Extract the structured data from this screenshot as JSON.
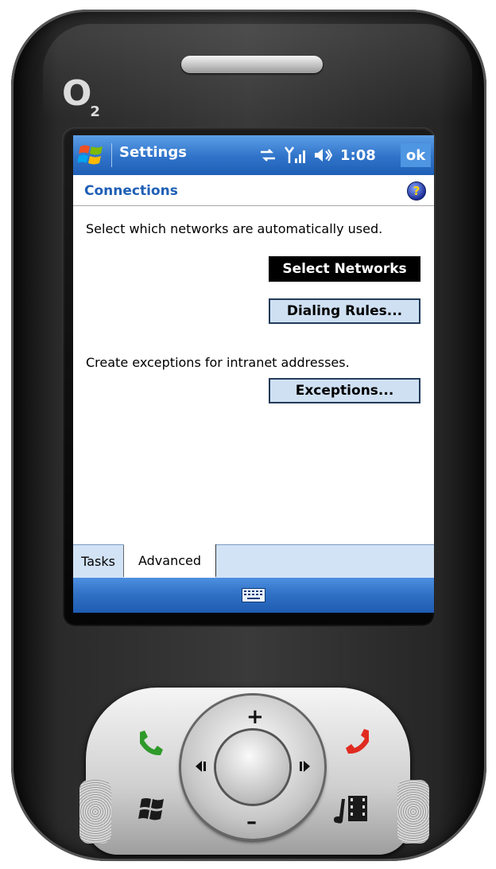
{
  "device": {
    "brand_logo": "O",
    "brand_logo_sub": "2"
  },
  "titlebar": {
    "app_title": "Settings",
    "time": "1:08",
    "ok_label": "ok"
  },
  "page": {
    "title": "Connections",
    "help": "?"
  },
  "content": {
    "networks_desc": "Select which networks are automatically used.",
    "select_networks_button": "Select Networks",
    "dialing_rules_button": "Dialing Rules...",
    "exceptions_desc": "Create exceptions for intranet addresses.",
    "exceptions_button": "Exceptions..."
  },
  "tabs": [
    {
      "label": "Tasks",
      "selected": false
    },
    {
      "label": "Advanced",
      "selected": true
    }
  ],
  "keypad": {
    "up": "+",
    "down": "–"
  },
  "colors": {
    "titlebar": "#2f73c9",
    "page_title": "#1f5fb6",
    "button_fill": "#cfe0f3",
    "tab_strip": "#d2e3f6"
  }
}
